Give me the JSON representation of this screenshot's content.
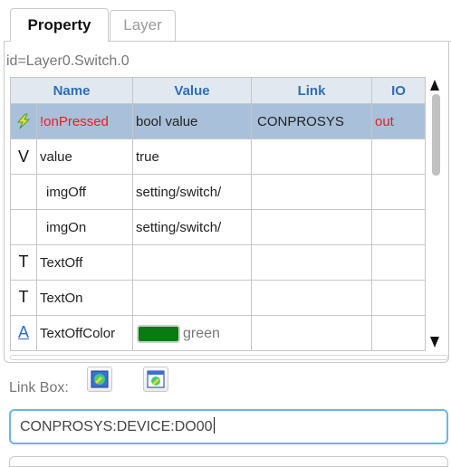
{
  "tabs": [
    {
      "label": "Property",
      "active": true
    },
    {
      "label": "Layer",
      "active": false
    }
  ],
  "element_id": "id=Layer0.Switch.0",
  "grid": {
    "columns": [
      "Name",
      "Value",
      "Link",
      "IO"
    ],
    "rows": [
      {
        "icon": "lightning-icon",
        "name": "!onPressed",
        "value": "bool value",
        "link": "CONPROSYS",
        "io": "out",
        "selected": true
      },
      {
        "icon": "V",
        "name": "value",
        "value": "true",
        "link": "",
        "io": ""
      },
      {
        "icon": "",
        "name": "imgOff",
        "value": "setting/switch/",
        "link": "",
        "io": ""
      },
      {
        "icon": "",
        "name": "imgOn",
        "value": "setting/switch/",
        "link": "",
        "io": ""
      },
      {
        "icon": "T",
        "name": "TextOff",
        "value": "",
        "link": "",
        "io": ""
      },
      {
        "icon": "T",
        "name": "TextOn",
        "value": "",
        "link": "",
        "io": ""
      },
      {
        "icon": "A",
        "name": "TextOffColor",
        "value": "green",
        "color_swatch": "#0a7a12",
        "link": "",
        "io": ""
      }
    ]
  },
  "link_box": {
    "label": "Link Box:",
    "value": "CONPROSYS:DEVICE:DO00"
  },
  "colors": {
    "header_bg": "#e2e8f0",
    "header_text": "#2e6eb5",
    "selected_row": "#a9c0da",
    "event_text": "#e8201a",
    "input_border": "#6cb6e8"
  }
}
